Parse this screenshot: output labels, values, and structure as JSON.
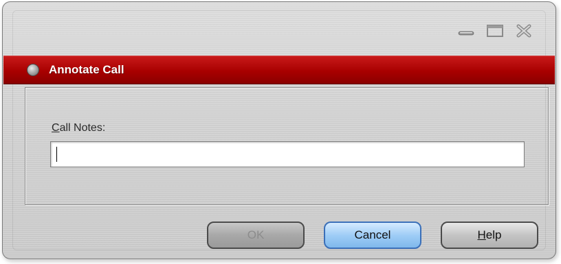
{
  "window": {
    "title": "Annotate Call",
    "controls": {
      "minimize_icon": "minimize-icon",
      "maximize_icon": "maximize-icon",
      "close_icon": "close-icon"
    }
  },
  "form": {
    "notes_label_mnemonic": "C",
    "notes_label_rest": "all Notes:",
    "notes_value": "",
    "notes_placeholder": ""
  },
  "buttons": {
    "ok_label": "OK",
    "cancel_label": "Cancel",
    "help_label_mnemonic": "H",
    "help_label_rest": "elp"
  },
  "colors": {
    "title_bar": "#a80000",
    "title_text": "#ffffff",
    "cancel_accent": "#9fcdf6",
    "disabled_text": "#8c8c8c"
  }
}
